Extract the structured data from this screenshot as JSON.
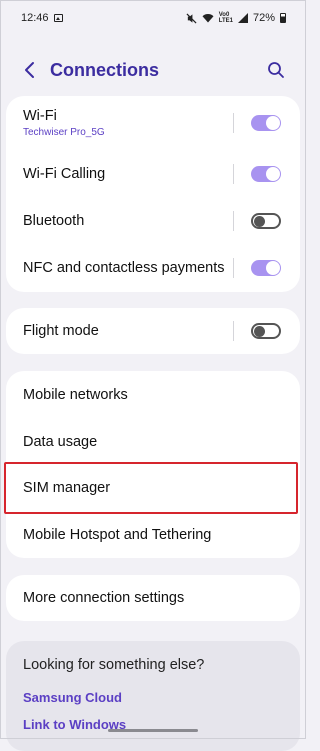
{
  "status_bar": {
    "time": "12:46",
    "signal_text_top": "Vo0",
    "signal_text_bottom": "LTE1",
    "battery_percent": "72%"
  },
  "header": {
    "title": "Connections"
  },
  "icons": {
    "back": "back-arrow-icon",
    "search": "search-icon",
    "gallery": "gallery-icon",
    "mute": "mute-icon",
    "wifi": "wifi-icon",
    "signal": "signal-icon",
    "battery": "battery-icon"
  },
  "colors": {
    "accent": "#3c2da0",
    "link": "#5b3fc4",
    "toggle_on": "#a893f0",
    "highlight": "#d6252d",
    "background": "#f2f1f6"
  },
  "card1": {
    "wifi": {
      "label": "Wi-Fi",
      "sub": "Techwiser Pro_5G",
      "on": true
    },
    "wifi_calling": {
      "label": "Wi-Fi Calling",
      "on": true
    },
    "bluetooth": {
      "label": "Bluetooth",
      "on": false
    },
    "nfc": {
      "label": "NFC and contactless payments",
      "on": true
    }
  },
  "card2": {
    "flight_mode": {
      "label": "Flight mode",
      "on": false
    }
  },
  "card3": {
    "mobile_networks": "Mobile networks",
    "data_usage": "Data usage",
    "sim_manager": "SIM manager",
    "hotspot": "Mobile Hotspot and Tethering"
  },
  "card4": {
    "more": "More connection settings"
  },
  "suggestions": {
    "title": "Looking for something else?",
    "links": [
      "Samsung Cloud",
      "Link to Windows"
    ]
  }
}
